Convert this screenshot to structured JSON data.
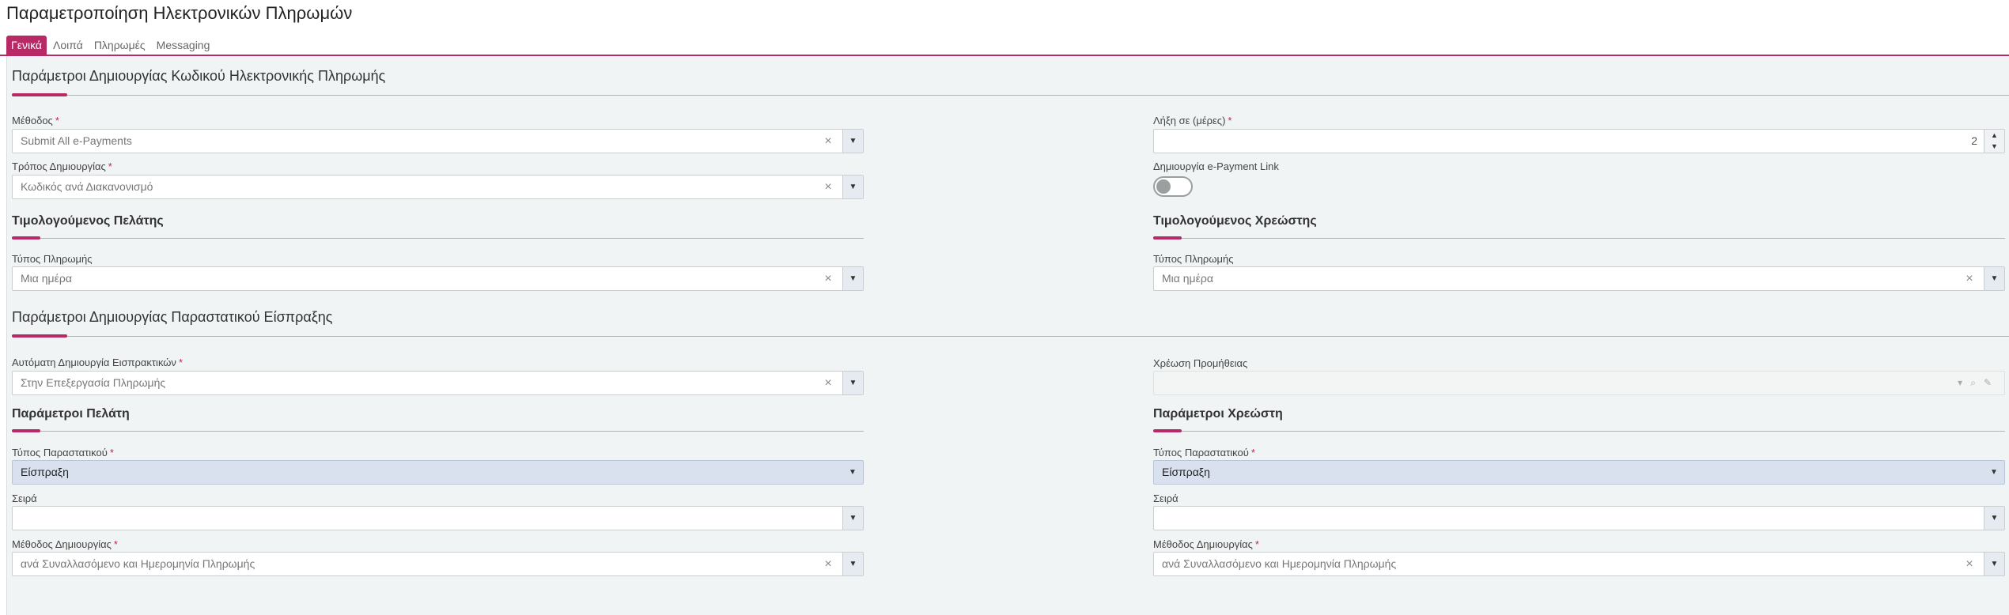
{
  "page": {
    "title": "Παραμετροποίηση Ηλεκτρονικών Πληρωμών"
  },
  "tabs": [
    {
      "label": "Γενικά",
      "active": true
    },
    {
      "label": "Λοιπά",
      "active": false
    },
    {
      "label": "Πληρωμές",
      "active": false
    },
    {
      "label": "Messaging",
      "active": false
    }
  ],
  "code_section": {
    "title": "Παράμετροι Δημιουργίας Κωδικού Ηλεκτρονικής Πληρωμής",
    "method": {
      "label": "Μέθοδος",
      "value": "Submit All e-Payments"
    },
    "creation_mode": {
      "label": "Τρόπος Δημιουργίας",
      "value": "Κωδικός ανά Διακανονισμό"
    },
    "expiry": {
      "label": "Λήξη σε (μέρες)",
      "value": "2"
    },
    "link": {
      "label": "Δημιουργία e-Payment Link",
      "enabled": false
    },
    "customer": {
      "title": "Τιμολογούμενος Πελάτης",
      "payment_type": {
        "label": "Τύπος Πληρωμής",
        "value": "Μια ημέρα"
      }
    },
    "debtor": {
      "title": "Τιμολογούμενος Χρεώστης",
      "payment_type": {
        "label": "Τύπος Πληρωμής",
        "value": "Μια ημέρα"
      }
    }
  },
  "receipt_section": {
    "title": "Παράμετροι Δημιουργίας Παραστατικού Είσπραξης",
    "auto_create": {
      "label": "Αυτόματη Δημιουργία Εισπρακτικών",
      "value": "Στην Επεξεργασία Πληρωμής"
    },
    "commission": {
      "label": "Χρέωση Προμήθειας",
      "value": ""
    },
    "customer": {
      "title": "Παράμετροι Πελάτη",
      "doc_type": {
        "label": "Τύπος Παραστατικού",
        "value": "Είσπραξη"
      },
      "series": {
        "label": "Σειρά",
        "value": ""
      },
      "creation_method": {
        "label": "Μέθοδος Δημιουργίας",
        "value": "ανά Συναλλασόμενο και Ημερομηνία Πληρωμής"
      }
    },
    "debtor": {
      "title": "Παράμετροι Χρεώστη",
      "doc_type": {
        "label": "Τύπος Παραστατικού",
        "value": "Είσπραξη"
      },
      "series": {
        "label": "Σειρά",
        "value": ""
      },
      "creation_method": {
        "label": "Μέθοδος Δημιουργίας",
        "value": "ανά Συναλλασόμενο και Ημερομηνία Πληρωμής"
      }
    }
  },
  "icons": {
    "clear": "×",
    "dropdown": "▼",
    "spin_up": "▲",
    "spin_down": "▼",
    "search": "search-icon",
    "edit": "pencil-icon"
  },
  "colors": {
    "accent": "#b72a66",
    "background": "#f1f4f4",
    "selected_field": "#d9e1ee"
  }
}
